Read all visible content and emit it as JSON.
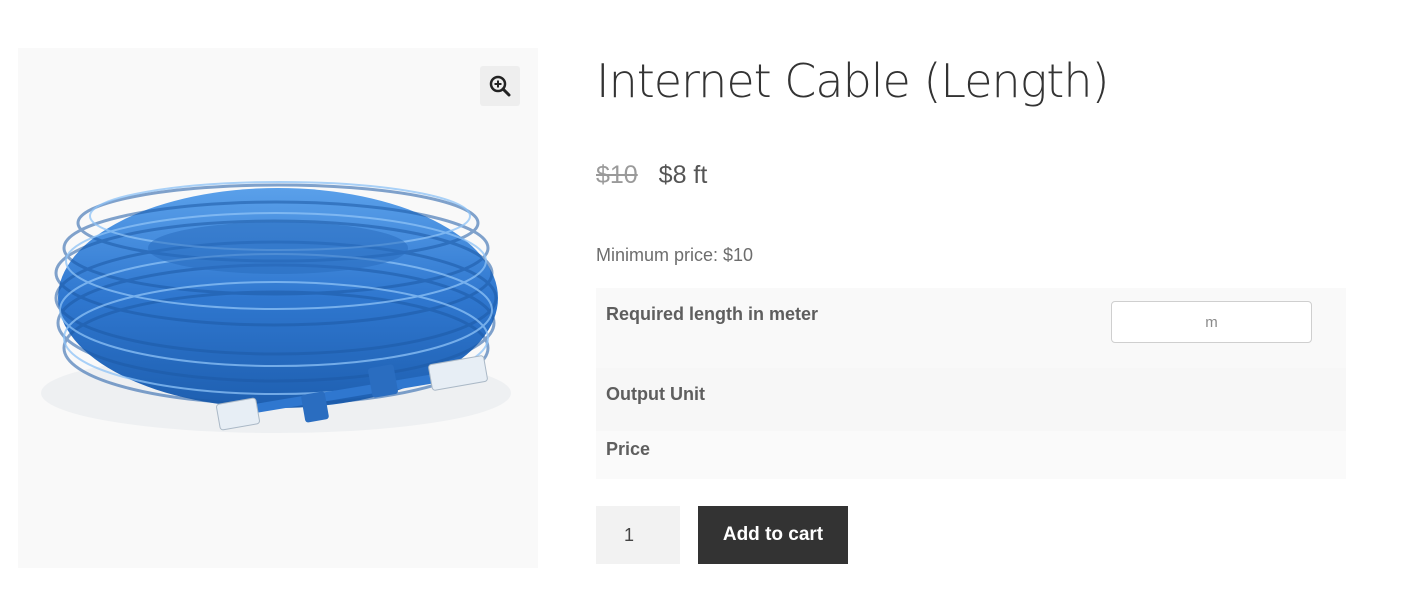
{
  "product": {
    "title": "Internet Cable (Length)",
    "price_old": "$10",
    "price_new": "$8 ft",
    "min_price": "Minimum price: $10"
  },
  "gallery": {
    "image_icon": "cable-coil",
    "zoom_icon": "magnifier-plus-icon",
    "cable_color": "#3a80d2"
  },
  "options": {
    "length_label": "Required length in meter",
    "length_placeholder": "m",
    "output_unit_label": "Output Unit",
    "price_label": "Price"
  },
  "cart": {
    "quantity": "1",
    "add_label": "Add to cart",
    "button_color": "#333333"
  }
}
